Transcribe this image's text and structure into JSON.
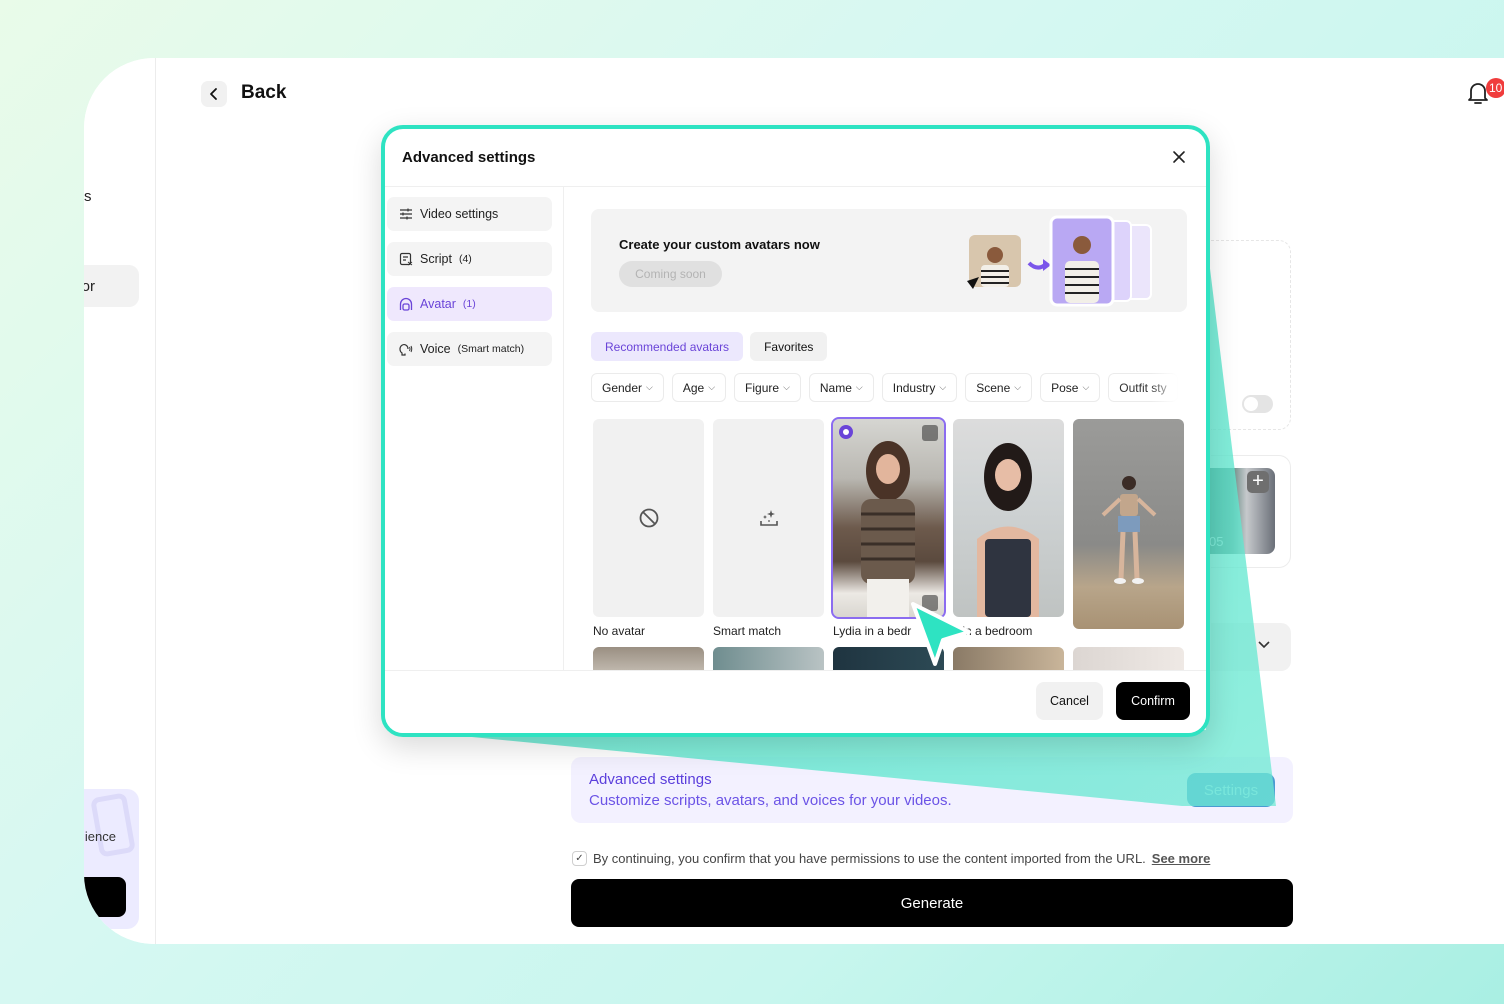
{
  "colors": {
    "accent_purple": "#6a44d8",
    "highlight_teal": "#2ee3c2",
    "badge_red": "#f03c3c",
    "primary_black": "#000000"
  },
  "sidebar": {
    "fragment_top": "s",
    "active_item_fragment": "or",
    "promo_text_fragment": "ience"
  },
  "header": {
    "back_label": "Back",
    "notification_icon": "bell-icon",
    "notification_count": "10"
  },
  "background_page": {
    "thumbnail_time_fragment": "05",
    "advanced_settings": {
      "title": "Advanced settings",
      "subtitle": "Customize scripts, avatars, and voices for your videos.",
      "button_label": "Settings"
    },
    "consent": {
      "checked": true,
      "text": "By continuing, you confirm that you have permissions to use the content imported from the URL.",
      "link_label": "See more"
    },
    "generate_label": "Generate"
  },
  "modal": {
    "title": "Advanced settings",
    "close_icon": "close-icon",
    "nav": [
      {
        "label": "Video settings",
        "count": "",
        "icon": "sliders-icon",
        "active": false
      },
      {
        "label": "Script",
        "count": "(4)",
        "icon": "script-icon",
        "active": false
      },
      {
        "label": "Avatar",
        "count": "(1)",
        "icon": "avatar-icon",
        "active": true
      },
      {
        "label": "Voice",
        "count": "(Smart match)",
        "icon": "voice-icon",
        "active": false
      }
    ],
    "promo": {
      "title": "Create your custom avatars now",
      "button_label": "Coming soon"
    },
    "tabs": [
      {
        "label": "Recommended avatars",
        "active": true
      },
      {
        "label": "Favorites",
        "active": false
      }
    ],
    "filters": [
      "Gender",
      "Age",
      "Figure",
      "Name",
      "Industry",
      "Scene",
      "Pose",
      "Outfit sty"
    ],
    "avatars": [
      {
        "label": "No avatar",
        "icon": "no-entry-icon",
        "selected": false
      },
      {
        "label": "Smart match",
        "icon": "sparkle-icon",
        "selected": false
      },
      {
        "label": "Lydia in a bedr",
        "selected": true
      },
      {
        "label": "x in a bedroom",
        "selected": false
      },
      {
        "label": "",
        "selected": false
      }
    ],
    "footer": {
      "cancel_label": "Cancel",
      "confirm_label": "Confirm"
    }
  }
}
